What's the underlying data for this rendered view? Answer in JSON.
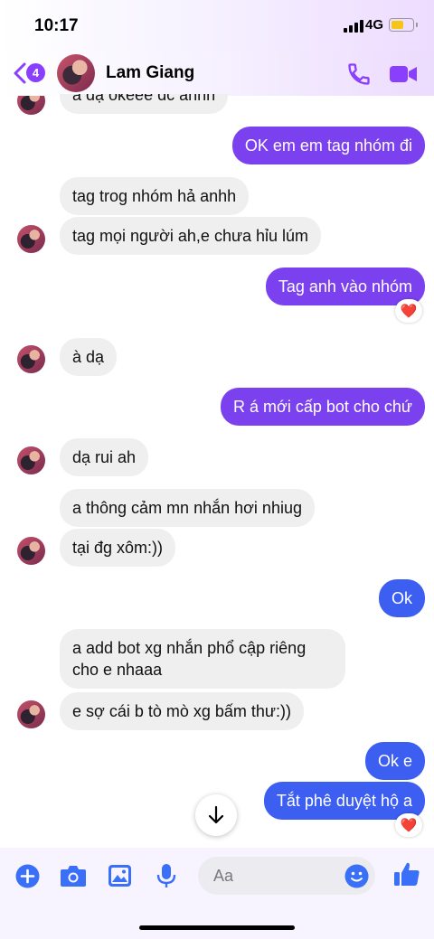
{
  "status_bar": {
    "time": "10:17",
    "network": "4G"
  },
  "header": {
    "back_count": "4",
    "contact_name": "Lam Giang"
  },
  "messages": [
    {
      "text": "a dạ okeee dc anhh"
    },
    {
      "text": "OK em em tag nhóm đi"
    },
    {
      "text": "tag trog nhóm hả anhh"
    },
    {
      "text": "tag mọi người ah,e chưa hỉu lúm"
    },
    {
      "text": "Tag anh vào nhóm"
    },
    {
      "text": "à dạ"
    },
    {
      "text": "R á mới cấp bot cho chứ"
    },
    {
      "text": "dạ rui ah"
    },
    {
      "text": "a thông cảm mn nhắn hơi nhiug"
    },
    {
      "text": "tại đg xôm:))"
    },
    {
      "text": "Ok"
    },
    {
      "text": "a add bot xg nhắn phổ cập riêng"
    },
    {
      "text": "cho e nhaaa"
    },
    {
      "text": "e sợ cái b tò mò xg bấm thư:))"
    },
    {
      "text": "Ok e"
    },
    {
      "text": "Tắt phê duyệt hộ a"
    }
  ],
  "reactions": {
    "heart": "❤️"
  },
  "composer": {
    "placeholder": "Aa"
  },
  "colors": {
    "purple": "#7b41ee",
    "blue": "#3c5ef1",
    "accent": "#8a3ffc"
  }
}
